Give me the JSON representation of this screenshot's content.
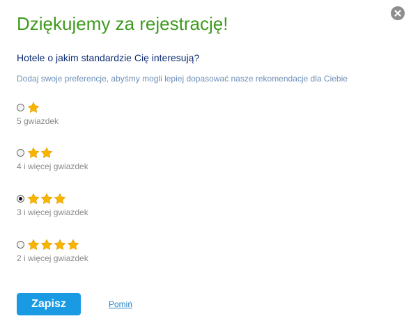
{
  "dialog": {
    "title": "Dziękujemy za rejestrację!",
    "question": "Hotele o jakim standardzie Cię interesują?",
    "hint": "Dodaj swoje preferencje, abyśmy mogli lepiej dopasować nasze rekomendacje dla Ciebie"
  },
  "options": [
    {
      "stars": 1,
      "label": "5 gwiazdek",
      "selected": false
    },
    {
      "stars": 2,
      "label": "4 i więcej gwiazdek",
      "selected": false
    },
    {
      "stars": 3,
      "label": "3 i więcej gwiazdek",
      "selected": true
    },
    {
      "stars": 4,
      "label": "2 i więcej gwiazdek",
      "selected": false
    }
  ],
  "actions": {
    "save_label": "Zapisz",
    "skip_label": "Pomiń"
  },
  "icons": {
    "close": "close-icon",
    "star": "star-icon"
  },
  "colors": {
    "title": "#3f9a1f",
    "question": "#0d2c73",
    "hint": "#6e8fb7",
    "star": "#f7b500",
    "button": "#1a9ae3",
    "link": "#2383c6"
  }
}
